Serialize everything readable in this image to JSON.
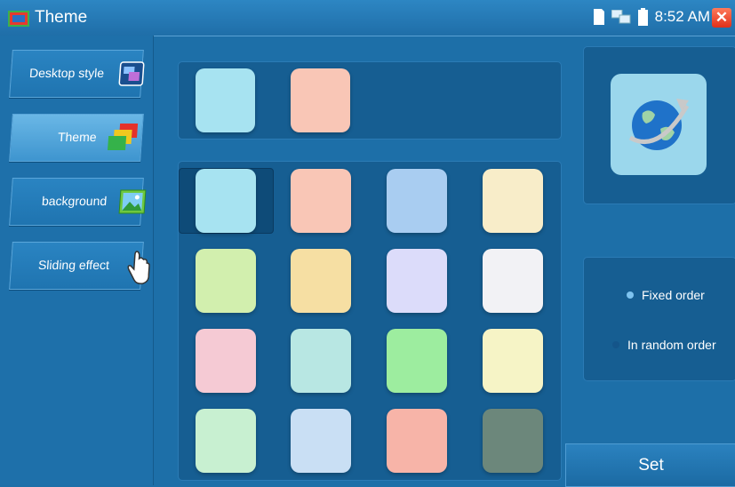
{
  "window": {
    "title": "Theme",
    "time": "8:52 AM"
  },
  "sidebar": {
    "items": [
      {
        "label": "Desktop style",
        "icon": "desktop-style-icon"
      },
      {
        "label": "Theme",
        "icon": "theme-layers-icon",
        "active": true
      },
      {
        "label": "background",
        "icon": "picture-icon"
      },
      {
        "label": "Sliding effect",
        "icon": "hand-pointer-icon"
      }
    ]
  },
  "preview_swatches": [
    "#a7e3f1",
    "#f9c6b6"
  ],
  "theme_swatches": [
    [
      "#a7e3f1",
      "#f9c6b6",
      "#a9cdf1",
      "#f8edc9"
    ],
    [
      "#d2efae",
      "#f6dfa3",
      "#dcdcfa",
      "#f2f2f5"
    ],
    [
      "#f5cad4",
      "#b8e7e3",
      "#9ded9f",
      "#f6f4c6"
    ],
    [
      "#c8f0d1",
      "#c9dff4",
      "#f7b4a8",
      "#6c877b"
    ]
  ],
  "selected_swatch": {
    "row": 0,
    "col": 0
  },
  "order_options": [
    {
      "label": "Fixed order",
      "selected": true
    },
    {
      "label": "In random order",
      "selected": false
    }
  ],
  "set_button": "Set",
  "colors": {
    "background": "#1d6fa8",
    "panel": "#165e92",
    "accent": "#7ec3ef"
  }
}
